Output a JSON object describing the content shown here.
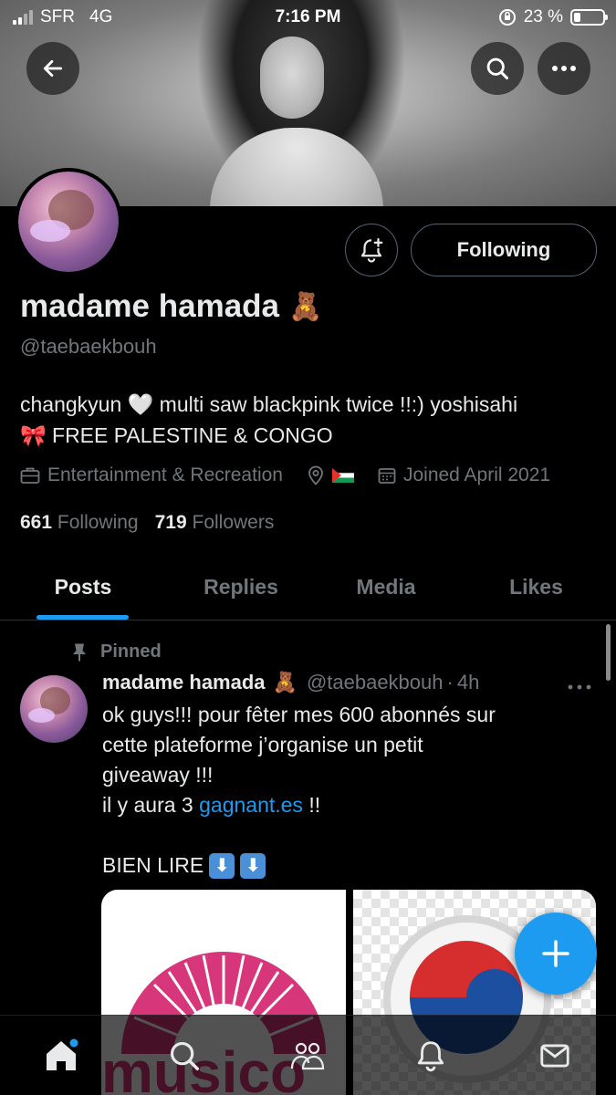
{
  "status_bar": {
    "carrier": "SFR",
    "network": "4G",
    "time": "7:16 PM",
    "battery_percent": "23 %",
    "battery_level": 0.23
  },
  "header": {
    "back_icon": "arrow-left-icon",
    "search_icon": "search-icon",
    "more_icon": "more-horizontal-icon"
  },
  "profile": {
    "display_name": "madame hamada",
    "name_emoji": "🧸",
    "handle": "@taebaekbouh",
    "follow_button": "Following",
    "bio_line1": "changkyun 🤍 multi saw blackpink twice !!:) yoshisahi",
    "bio_line2": "🎀 FREE PALESTINE & CONGO",
    "category": "Entertainment & Recreation",
    "location": "🇵🇸",
    "joined": "Joined April 2021",
    "following_count": "661",
    "following_label": "Following",
    "followers_count": "719",
    "followers_label": "Followers"
  },
  "tabs": [
    {
      "label": "Posts",
      "active": true
    },
    {
      "label": "Replies",
      "active": false
    },
    {
      "label": "Media",
      "active": false
    },
    {
      "label": "Likes",
      "active": false
    }
  ],
  "pinned_post": {
    "pinned_label": "Pinned",
    "author_name": "madame hamada",
    "author_emoji": "🧸",
    "author_handle": "@taebaekbouh",
    "separator": "·",
    "time": "4h",
    "line1": "ok guys!!! pour fêter mes 600 abonnés sur",
    "line2": "cette plateforme j’organise un petit",
    "line3": "giveaway !!!",
    "line4_prefix": "il y aura 3 ",
    "line4_link": "gagnant.es",
    "line4_suffix": " !!",
    "line5": "BIEN LIRE",
    "line5_emoji": "⬇",
    "media_left_text": "musico"
  },
  "bottom_nav": {
    "items": [
      "home-icon",
      "search-icon",
      "communities-icon",
      "notifications-icon",
      "messages-icon"
    ]
  },
  "colors": {
    "accent": "#1d9bf0",
    "text": "#e7e9ea",
    "muted": "#71767b",
    "border": "#2f3336",
    "background": "#000000"
  }
}
